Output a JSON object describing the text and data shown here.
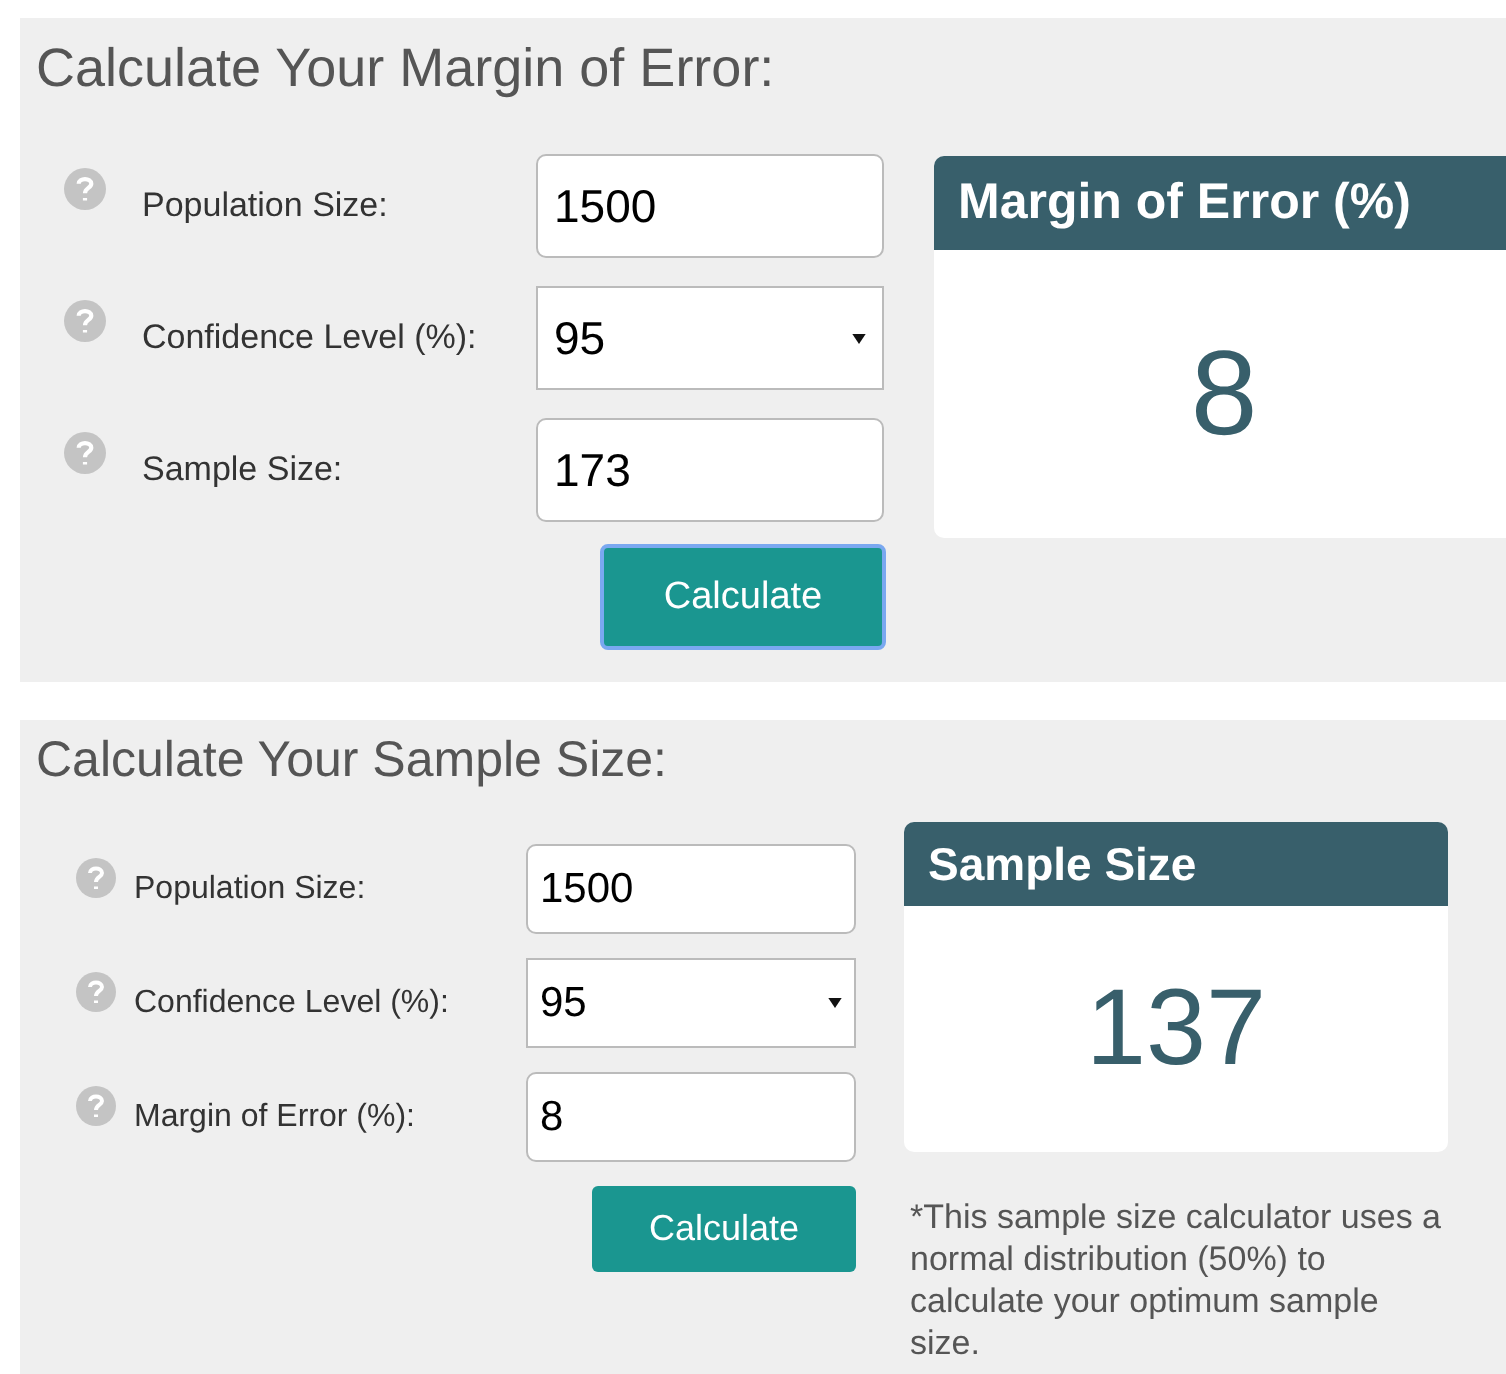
{
  "calculators": [
    {
      "title": "Calculate Your Margin of Error:",
      "fields": [
        {
          "label": "Population Size:",
          "kind": "input",
          "value": "1500"
        },
        {
          "label": "Confidence Level (%):",
          "kind": "select",
          "value": "95"
        },
        {
          "label": "Sample Size:",
          "kind": "input",
          "value": "173"
        }
      ],
      "button": {
        "label": "Calculate",
        "focused": true
      },
      "result": {
        "heading": "Margin of Error (%)",
        "value": "8"
      }
    },
    {
      "title": "Calculate Your Sample Size:",
      "fields": [
        {
          "label": "Population Size:",
          "kind": "input",
          "value": "1500"
        },
        {
          "label": "Confidence Level (%):",
          "kind": "select",
          "value": "95"
        },
        {
          "label": "Margin of Error (%):",
          "kind": "input",
          "value": "8"
        }
      ],
      "button": {
        "label": "Calculate",
        "focused": false
      },
      "result": {
        "heading": "Sample Size",
        "value": "137"
      },
      "note": "*This sample size calculator uses a normal distribution (50%) to calculate your optimum sample size."
    }
  ]
}
